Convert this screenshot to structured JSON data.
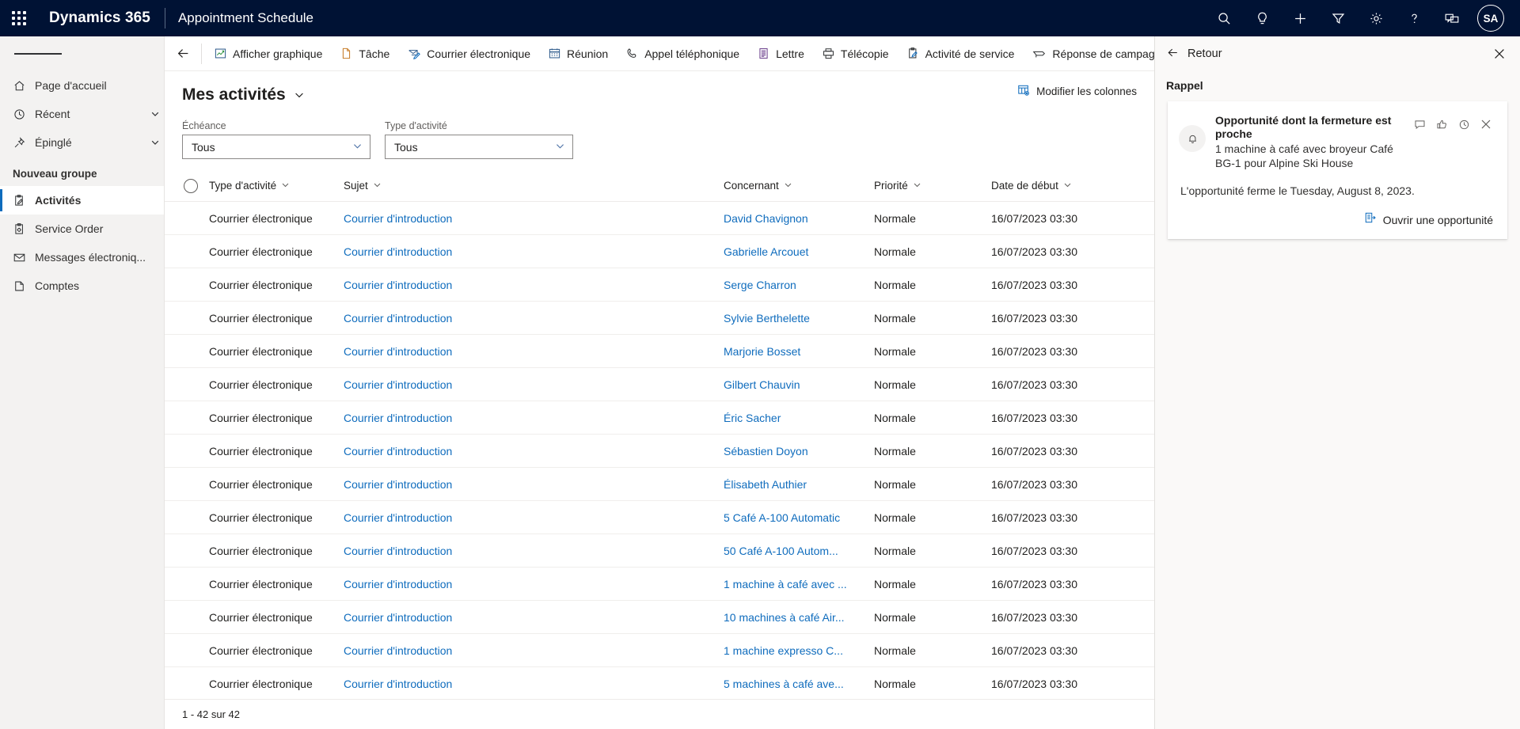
{
  "topnav": {
    "waffle_icon": "app-launcher-icon",
    "brand": "Dynamics 365",
    "app_name": "Appointment Schedule",
    "icons": [
      {
        "name": "search-icon",
        "label": "Recherche"
      },
      {
        "name": "lightbulb-icon",
        "label": "Assistant"
      },
      {
        "name": "plus-icon",
        "label": "Nouveau"
      },
      {
        "name": "filter-icon",
        "label": "Filtre"
      },
      {
        "name": "gear-icon",
        "label": "Paramètres"
      },
      {
        "name": "help-icon",
        "label": "Aide"
      },
      {
        "name": "feedback-icon",
        "label": "Commentaires"
      }
    ],
    "avatar_initials": "SA"
  },
  "sidebar": {
    "hamburger_label": "Développer le volet de navigation",
    "top_items": [
      {
        "label": "Page d'accueil",
        "icon": "home-icon",
        "chevron": false
      },
      {
        "label": "Récent",
        "icon": "clock-icon",
        "chevron": true
      },
      {
        "label": "Épinglé",
        "icon": "pin-icon",
        "chevron": true
      }
    ],
    "group_label": "Nouveau groupe",
    "group_items": [
      {
        "label": "Activités",
        "icon": "activity-icon",
        "selected": true
      },
      {
        "label": "Service Order",
        "icon": "clipboard-gear-icon",
        "selected": false
      },
      {
        "label": "Messages électroniq...",
        "icon": "envelope-icon",
        "selected": false
      },
      {
        "label": "Comptes",
        "icon": "account-icon",
        "selected": false
      }
    ]
  },
  "commandbar": {
    "back_label": "Précédent",
    "buttons": [
      {
        "label": "Afficher graphique",
        "icon": "chart-icon"
      },
      {
        "label": "Tâche",
        "icon": "task-icon"
      },
      {
        "label": "Courrier électronique",
        "icon": "email-icon"
      },
      {
        "label": "Réunion",
        "icon": "calendar-icon"
      },
      {
        "label": "Appel téléphonique",
        "icon": "phone-icon"
      },
      {
        "label": "Lettre",
        "icon": "letter-icon"
      },
      {
        "label": "Télécopie",
        "icon": "fax-icon"
      },
      {
        "label": "Activité de service",
        "icon": "service-activity-icon"
      },
      {
        "label": "Réponse de campagne",
        "icon": "campaign-response-icon"
      }
    ]
  },
  "view": {
    "title": "Mes activités",
    "title_chevron_icon": "chevron-down-icon",
    "edit_columns_label": "Modifier les colonnes",
    "edit_columns_icon": "edit-columns-icon"
  },
  "filters": [
    {
      "label": "Échéance",
      "value": "Tous",
      "name": "due-date-filter"
    },
    {
      "label": "Type d'activité",
      "value": "Tous",
      "name": "activity-type-filter"
    }
  ],
  "grid": {
    "columns": [
      {
        "key": "type",
        "label": "Type d'activité",
        "sortable": true
      },
      {
        "key": "subject",
        "label": "Sujet",
        "sortable": true
      },
      {
        "key": "regarding",
        "label": "Concernant",
        "sortable": true
      },
      {
        "key": "priority",
        "label": "Priorité",
        "sortable": true
      },
      {
        "key": "start",
        "label": "Date de début",
        "sortable": true
      }
    ],
    "rows": [
      {
        "type": "Courrier électronique",
        "subject": "Courrier d'introduction",
        "regarding": "David Chavignon",
        "priority": "Normale",
        "start": "16/07/2023 03:30"
      },
      {
        "type": "Courrier électronique",
        "subject": "Courrier d'introduction",
        "regarding": "Gabrielle Arcouet",
        "priority": "Normale",
        "start": "16/07/2023 03:30"
      },
      {
        "type": "Courrier électronique",
        "subject": "Courrier d'introduction",
        "regarding": "Serge Charron",
        "priority": "Normale",
        "start": "16/07/2023 03:30"
      },
      {
        "type": "Courrier électronique",
        "subject": "Courrier d'introduction",
        "regarding": "Sylvie Berthelette",
        "priority": "Normale",
        "start": "16/07/2023 03:30"
      },
      {
        "type": "Courrier électronique",
        "subject": "Courrier d'introduction",
        "regarding": "Marjorie Bosset",
        "priority": "Normale",
        "start": "16/07/2023 03:30"
      },
      {
        "type": "Courrier électronique",
        "subject": "Courrier d'introduction",
        "regarding": "Gilbert Chauvin",
        "priority": "Normale",
        "start": "16/07/2023 03:30"
      },
      {
        "type": "Courrier électronique",
        "subject": "Courrier d'introduction",
        "regarding": "Éric Sacher",
        "priority": "Normale",
        "start": "16/07/2023 03:30"
      },
      {
        "type": "Courrier électronique",
        "subject": "Courrier d'introduction",
        "regarding": "Sébastien Doyon",
        "priority": "Normale",
        "start": "16/07/2023 03:30"
      },
      {
        "type": "Courrier électronique",
        "subject": "Courrier d'introduction",
        "regarding": "Élisabeth Authier",
        "priority": "Normale",
        "start": "16/07/2023 03:30"
      },
      {
        "type": "Courrier électronique",
        "subject": "Courrier d'introduction",
        "regarding": "5 Café A-100 Automatic",
        "priority": "Normale",
        "start": "16/07/2023 03:30"
      },
      {
        "type": "Courrier électronique",
        "subject": "Courrier d'introduction",
        "regarding": "50 Café A-100 Autom...",
        "priority": "Normale",
        "start": "16/07/2023 03:30"
      },
      {
        "type": "Courrier électronique",
        "subject": "Courrier d'introduction",
        "regarding": "1 machine à café avec ...",
        "priority": "Normale",
        "start": "16/07/2023 03:30"
      },
      {
        "type": "Courrier électronique",
        "subject": "Courrier d'introduction",
        "regarding": "10 machines à café Air...",
        "priority": "Normale",
        "start": "16/07/2023 03:30"
      },
      {
        "type": "Courrier électronique",
        "subject": "Courrier d'introduction",
        "regarding": "1 machine expresso C...",
        "priority": "Normale",
        "start": "16/07/2023 03:30"
      },
      {
        "type": "Courrier électronique",
        "subject": "Courrier d'introduction",
        "regarding": "5 machines à café ave...",
        "priority": "Normale",
        "start": "16/07/2023 03:30"
      }
    ],
    "footer": "1 - 42 sur 42"
  },
  "rightpanel": {
    "back_label": "Retour",
    "back_icon": "arrow-left-icon",
    "close_icon": "close-icon",
    "section_title": "Rappel",
    "card": {
      "bell_icon": "bell-icon",
      "title": "Opportunité dont la fermeture est proche",
      "subtitle": "1 machine à café avec broyeur Café BG-1 pour Alpine Ski House",
      "actions": [
        {
          "name": "snooze-comment-icon",
          "label": "Commentaire"
        },
        {
          "name": "thumbs-up-icon",
          "label": "J'aime"
        },
        {
          "name": "snooze-clock-icon",
          "label": "Répéter"
        },
        {
          "name": "dismiss-icon",
          "label": "Ignorer"
        }
      ],
      "note": "L'opportunité ferme le Tuesday, August 8, 2023.",
      "cta_label": "Ouvrir une opportunité",
      "cta_icon": "open-record-icon"
    }
  },
  "colors": {
    "nav_background": "#001234",
    "accent": "#0f6cbd",
    "sidebar_background": "#f3f2f1",
    "panel_background": "#faf9f8"
  }
}
